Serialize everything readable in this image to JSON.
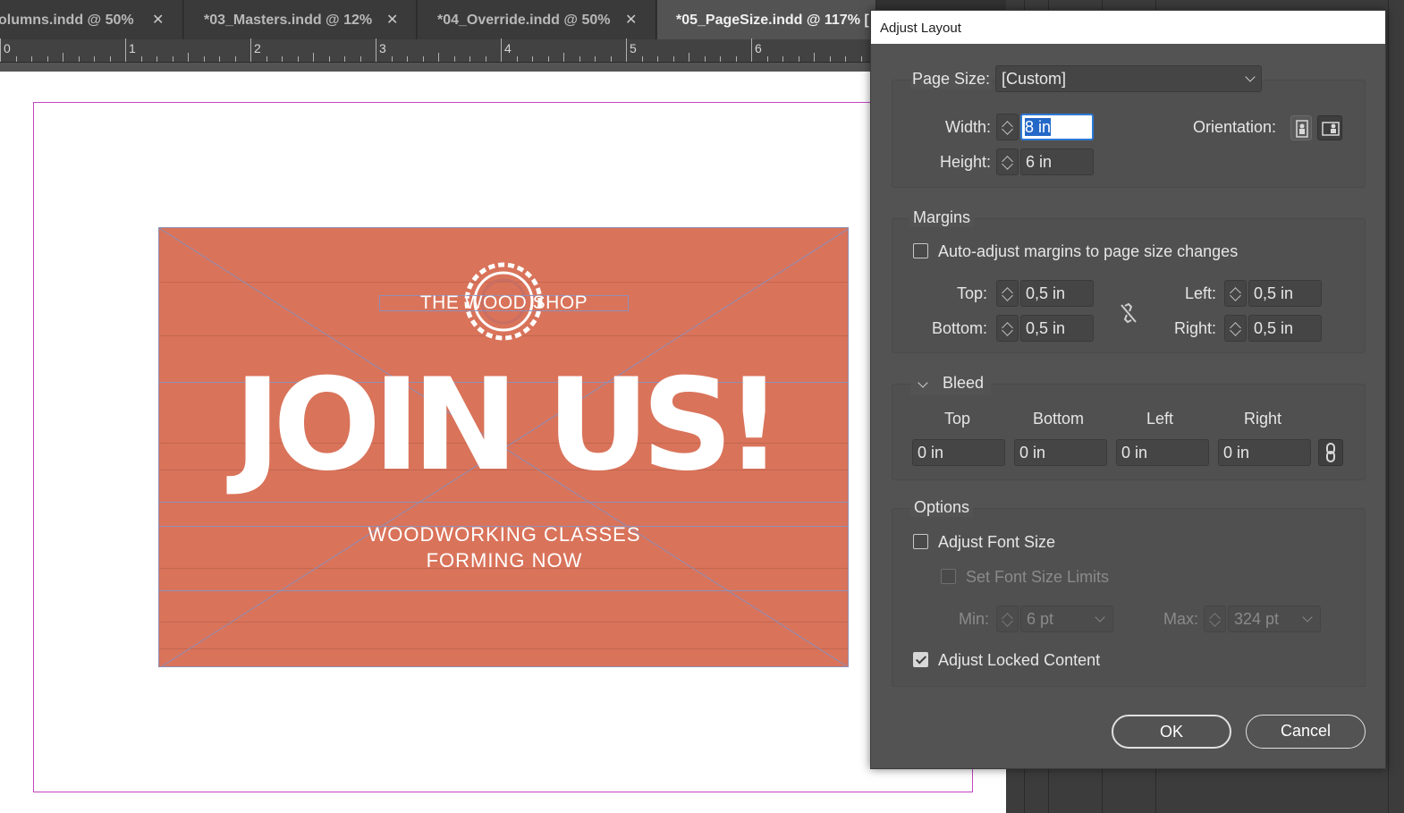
{
  "tabs": [
    {
      "label": "olumns.indd @ 50%",
      "close": "✕"
    },
    {
      "label": "*03_Masters.indd @ 12%",
      "close": "✕"
    },
    {
      "label": "*04_Override.indd @ 50%",
      "close": "✕"
    },
    {
      "label": "*05_PageSize.indd @ 117% [",
      "close": ""
    }
  ],
  "ruler": {
    "numbers": [
      "0",
      "1",
      "2",
      "3",
      "4",
      "5",
      "6"
    ]
  },
  "artwork": {
    "shop_name": "THE WOOD SHOP",
    "headline": "JOIN US!",
    "subline_1": "WOODWORKING CLASSES",
    "subline_2": "FORMING NOW",
    "background_color": "#d9735a"
  },
  "dialog": {
    "title": "Adjust Layout",
    "page_size": {
      "label": "Page Size:",
      "value": "[Custom]"
    },
    "width": {
      "label": "Width:",
      "value": "8 in"
    },
    "height": {
      "label": "Height:",
      "value": "6 in"
    },
    "orientation": {
      "label": "Orientation:",
      "options": [
        "portrait-icon",
        "landscape-icon"
      ],
      "selected": "landscape"
    },
    "margins": {
      "title": "Margins",
      "auto_adjust": {
        "label": "Auto-adjust margins to page size changes",
        "checked": false
      },
      "top": {
        "label": "Top:",
        "value": "0,5 in"
      },
      "bottom": {
        "label": "Bottom:",
        "value": "0,5 in"
      },
      "left": {
        "label": "Left:",
        "value": "0,5 in"
      },
      "right": {
        "label": "Right:",
        "value": "0,5 in"
      }
    },
    "bleed": {
      "title": "Bleed",
      "headers": [
        "Top",
        "Bottom",
        "Left",
        "Right"
      ],
      "values": [
        "0 in",
        "0 in",
        "0 in",
        "0 in"
      ]
    },
    "options": {
      "title": "Options",
      "adjust_font_size": {
        "label": "Adjust Font Size",
        "checked": false
      },
      "set_font_size_limits": {
        "label": "Set Font Size Limits",
        "checked": false
      },
      "min": {
        "label": "Min:",
        "value": "6 pt"
      },
      "max": {
        "label": "Max:",
        "value": "324 pt"
      },
      "adjust_locked": {
        "label": "Adjust Locked Content",
        "checked": true
      }
    },
    "ok_label": "OK",
    "cancel_label": "Cancel"
  }
}
